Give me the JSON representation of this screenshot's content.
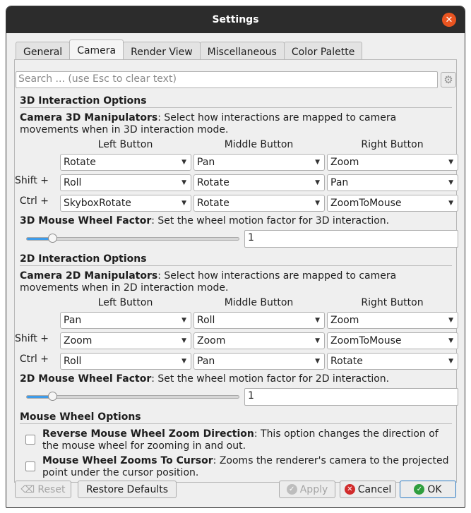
{
  "window": {
    "title": "Settings"
  },
  "tabs": [
    "General",
    "Camera",
    "Render View",
    "Miscellaneous",
    "Color Palette"
  ],
  "search": {
    "placeholder": "Search ... (use Esc to clear text)"
  },
  "sections": {
    "interaction3d": {
      "title": "3D Interaction Options",
      "manip_label": "Camera 3D Manipulators",
      "manip_desc": ": Select how interactions are mapped to camera movements when in 3D interaction mode.",
      "columns": [
        "Left Button",
        "Middle Button",
        "Right Button"
      ],
      "rows": [
        {
          "modifier": "",
          "values": [
            "Rotate",
            "Pan",
            "Zoom"
          ]
        },
        {
          "modifier": "Shift +",
          "values": [
            "Roll",
            "Rotate",
            "Pan"
          ]
        },
        {
          "modifier": "Ctrl +",
          "values": [
            "SkyboxRotate",
            "Rotate",
            "ZoomToMouse"
          ]
        }
      ],
      "wheel_label": "3D Mouse Wheel Factor",
      "wheel_desc": ": Set the wheel motion factor for 3D interaction.",
      "wheel_value": "1",
      "slider_level": 0.12
    },
    "interaction2d": {
      "title": "2D Interaction Options",
      "manip_label": "Camera 2D Manipulators",
      "manip_desc": ": Select how interactions are mapped to camera movements when in 2D interaction mode.",
      "columns": [
        "Left Button",
        "Middle Button",
        "Right Button"
      ],
      "rows": [
        {
          "modifier": "",
          "values": [
            "Pan",
            "Roll",
            "Zoom"
          ]
        },
        {
          "modifier": "Shift +",
          "values": [
            "Zoom",
            "Zoom",
            "ZoomToMouse"
          ]
        },
        {
          "modifier": "Ctrl +",
          "values": [
            "Roll",
            "Pan",
            "Rotate"
          ]
        }
      ],
      "wheel_label": "2D Mouse Wheel Factor",
      "wheel_desc": ": Set the wheel motion factor for 2D interaction.",
      "wheel_value": "1",
      "slider_level": 0.12
    },
    "mousewheel": {
      "title": "Mouse Wheel Options",
      "options": [
        {
          "label": "Reverse Mouse Wheel Zoom Direction",
          "desc": ": This option changes the direction of the mouse wheel for zooming in and out.",
          "checked": false
        },
        {
          "label": "Mouse Wheel Zooms To Cursor",
          "desc": ": Zooms the renderer's camera to the projected point under the cursor position.",
          "checked": false
        }
      ]
    }
  },
  "buttons": {
    "reset": "Reset",
    "restore": "Restore Defaults",
    "apply": "Apply",
    "cancel": "Cancel",
    "ok": "OK"
  },
  "colors": {
    "accent": "#3d9be9",
    "close": "#e95420",
    "cancel_icon": "#d12b2b",
    "ok_icon": "#2e9e3e"
  }
}
